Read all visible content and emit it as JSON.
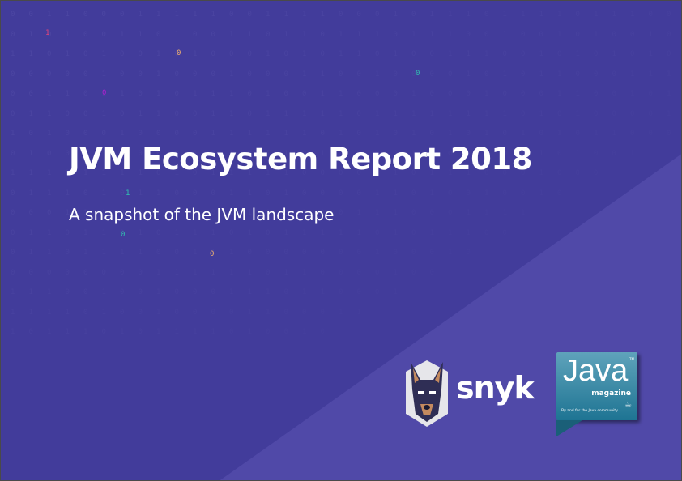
{
  "title": "JVM Ecosystem Report 2018",
  "subtitle": "A snapshot of the JVM landscape",
  "highlighted_bits": [
    {
      "text": "1",
      "color": "#e0447a"
    },
    {
      "text": "0",
      "color": "#f0b070"
    },
    {
      "text": "0",
      "color": "#b020d0"
    },
    {
      "text": "0",
      "color": "#30c0b0"
    },
    {
      "text": "1",
      "color": "#30c0b0"
    },
    {
      "text": "0",
      "color": "#30c0b0"
    },
    {
      "text": "0",
      "color": "#f0b070"
    }
  ],
  "snyk": {
    "wordmark": "snyk"
  },
  "java_magazine": {
    "java": "Java",
    "trademark": "TM",
    "magazine": "magazine",
    "tagline": "By and for the Java community"
  },
  "colors": {
    "background": "#423c9b",
    "triangle": "#5049a8"
  }
}
